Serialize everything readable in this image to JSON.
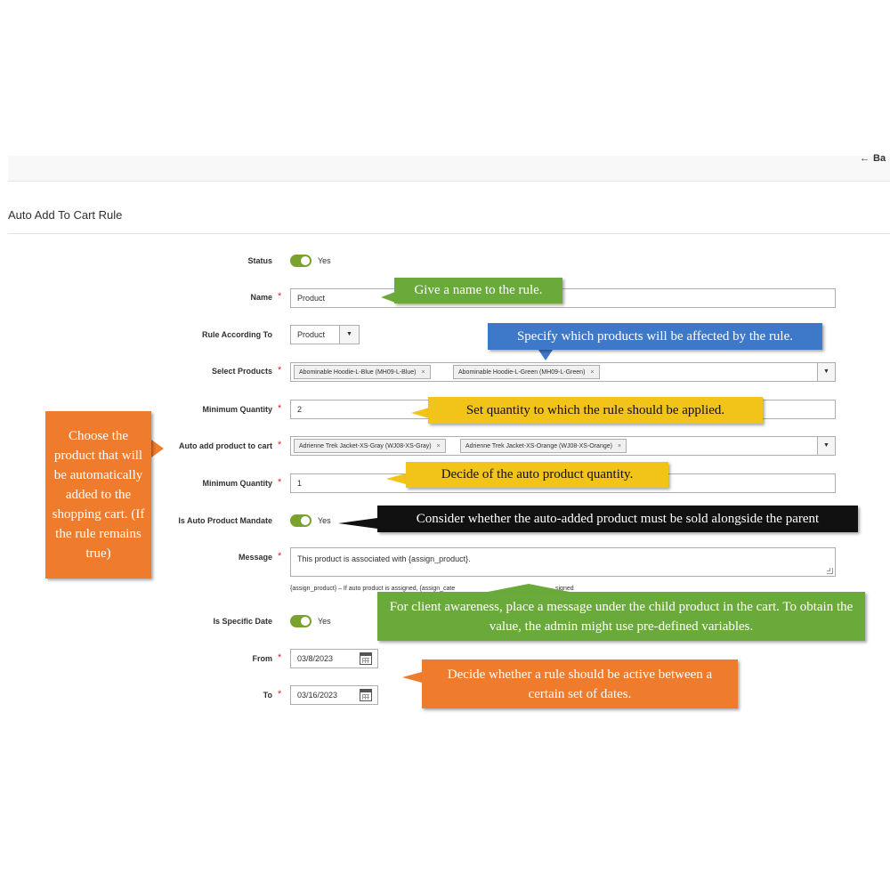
{
  "header": {
    "back_label": "Ba",
    "back_arrow": "←"
  },
  "section": {
    "title": "Auto Add To Cart Rule"
  },
  "form": {
    "status": {
      "label": "Status",
      "value": "Yes"
    },
    "name": {
      "label": "Name",
      "value": "Product"
    },
    "rule_according_to": {
      "label": "Rule According To",
      "value": "Product"
    },
    "select_products": {
      "label": "Select Products",
      "chips": [
        "Abominable Hoodie-L-Blue (MH09-L-Blue)",
        "Abominable Hoodie-L-Green (MH09-L-Green)"
      ]
    },
    "minimum_quantity": {
      "label": "Minimum Quantity",
      "value": "2"
    },
    "auto_add_product": {
      "label": "Auto add product to cart",
      "chips": [
        "Adrienne Trek Jacket-XS-Gray (WJ08-XS-Gray)",
        "Adrienne Trek Jacket-XS-Orange (WJ08-XS-Orange)"
      ]
    },
    "auto_minimum_quantity": {
      "label": "Minimum Quantity",
      "value": "1"
    },
    "is_auto_product_mandate": {
      "label": "Is Auto Product Mandate",
      "value": "Yes"
    },
    "message": {
      "label": "Message",
      "value": "This product is associated with {assign_product}.",
      "hint": "{assign_product} – If auto product is assigned, {assign_cate",
      "hint_tail": "signed"
    },
    "is_specific_date": {
      "label": "Is Specific Date",
      "value": "Yes"
    },
    "from": {
      "label": "From",
      "value": "03/8/2023"
    },
    "to": {
      "label": "To",
      "value": "03/16/2023"
    },
    "required_mark": "*",
    "remove_mark": "×",
    "dropdown_mark": "▼"
  },
  "callouts": {
    "name": "Give a name to the rule.",
    "products": "Specify which products will be affected by the rule.",
    "quantity": "Set quantity to which the rule should be applied.",
    "auto_quantity": "Decide of the auto product quantity.",
    "mandate": "Consider whether the auto-added product must be sold alongside the parent",
    "message": "For client awareness, place a message under the child product in the cart. To obtain the value, the admin might use pre-defined variables.",
    "dates": "Decide whether a rule should be active between a certain set of dates.",
    "auto_product": "Choose the product that will be automatically added to the shopping cart. (If the rule remains true)"
  },
  "colors": {
    "green_callout": "#6aaa3a",
    "blue_callout": "#3e78c8",
    "yellow_callout": "#f2c318",
    "black_callout": "#111111",
    "orange_callout": "#ef7b2d",
    "toggle_on": "#79a22e",
    "required": "#e22626"
  }
}
